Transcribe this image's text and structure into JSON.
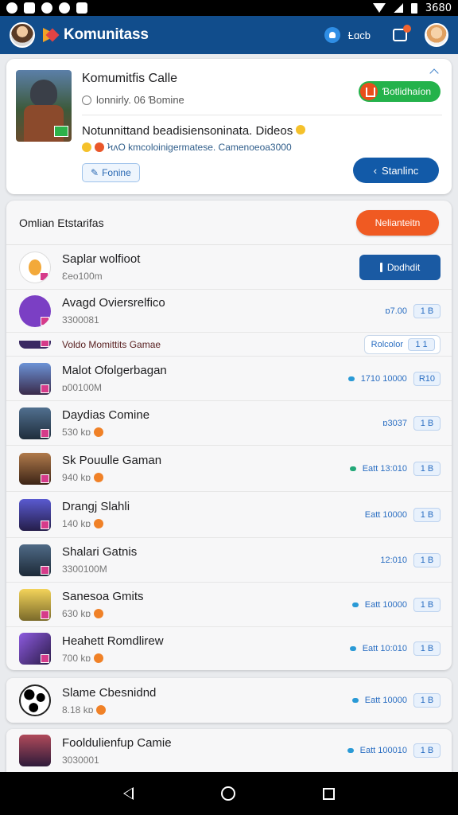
{
  "status_bar": {
    "time": "3680"
  },
  "app_bar": {
    "title": "Komunitass",
    "bell_label": "Ƚɑcb"
  },
  "hero": {
    "title": "Komumitfis Calle",
    "subtitle": "Ɩonnirly. 06 Ɓomine",
    "cta_label": "Ɓotlidhaíon",
    "description": "Notunnittand beadisiensoninata. Dideos",
    "description2": "ϞᴧΟ kmcoloinigermatese. Camenoeoa3000",
    "tag_label": "Fonine",
    "play_label": "Stanlinc"
  },
  "list": {
    "header_title": "Omlian Etstarifas",
    "header_button": "Nelianteitn",
    "items": [
      {
        "name": "Saplar wolfioot",
        "meta": "Ɛeo100m",
        "action": "Dɒdhdit",
        "icon_color": "#f3a93a"
      },
      {
        "name": "Avagd Oviersrelfico",
        "meta": "3300081",
        "right_text": "ɒ7.00",
        "chip": "1 B",
        "icon_color": "#7b3fc4"
      },
      {
        "name": "Voldo Momittits Gamae",
        "right_text": "Rolcolor",
        "chip": "1 1",
        "icon_color": "#3b2a63"
      },
      {
        "name": "Malot Ofolgerbagan",
        "meta": "ɒ00100M",
        "right_text": "1710 10000",
        "chip": "R10",
        "icon_color": "#4b6aa8"
      },
      {
        "name": "Daydias Comine",
        "meta": "530 kɒ",
        "right_text": "ɒ3037",
        "chip": "1 B",
        "icon_color": "#2f4a66"
      },
      {
        "name": "Sk Pouulle Gaman",
        "meta": "940 kɒ",
        "right_text": "Eatt 13:010",
        "chip": "1 B",
        "icon_color": "#7a4a2a"
      },
      {
        "name": "Drangj Slahli",
        "meta": "140 kɒ",
        "right_text": "Eatt 10000",
        "chip": "1 B",
        "icon_color": "#3d3a8c"
      },
      {
        "name": "Shalari Gatnis",
        "meta": "3300100M",
        "right_text": "12:010",
        "chip": "1 B",
        "icon_color": "#31465e"
      },
      {
        "name": "Sanesoa Gmits",
        "meta": "630 kɒ",
        "right_text": "Eatt 10000",
        "chip": "1 B",
        "icon_color": "#d6a71e"
      },
      {
        "name": "Heahett Romdlirew",
        "meta": "700 kɒ",
        "right_text": "Eatt 10:010",
        "chip": "1 B",
        "icon_color": "#6a3aa0"
      }
    ]
  },
  "card_a": {
    "name": "Slame Cbesnidnd",
    "meta": "8.18 kɒ",
    "right_text": "Eatt 10000",
    "chip": "1 B"
  },
  "card_b": {
    "name": "Fooldulienfup Camie",
    "meta": "3030001",
    "right_text": "Eatt 100010",
    "chip": "1 B"
  }
}
